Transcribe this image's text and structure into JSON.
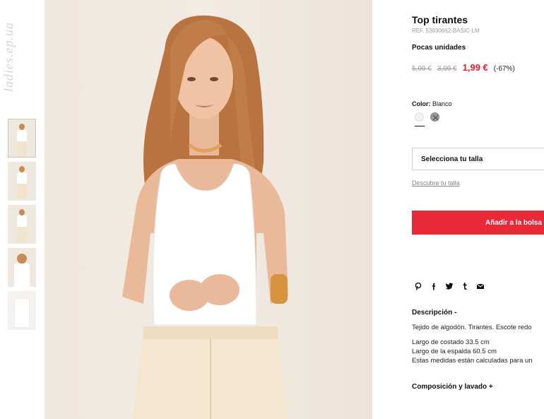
{
  "watermark": "ladies.ep.ua",
  "thumbnails": [
    "thumb-1",
    "thumb-2",
    "thumb-3",
    "thumb-4",
    "thumb-5"
  ],
  "product": {
    "title": "Top tirantes",
    "ref": "REF. 53030662-BASIC-LM",
    "stock": "Pocas unidades",
    "prices": {
      "old1": "5,99 €",
      "old2": "3,99 €",
      "sale": "1,99 €",
      "discount": "(-67%)"
    },
    "color_label": "Color:",
    "color_value": "Blanco",
    "swatches": [
      {
        "name": "Blanco",
        "hex": "#f2f2f2"
      },
      {
        "name": "Gris",
        "hex": "#9a9a9a"
      }
    ],
    "size_select": "Selecciona tu talla",
    "size_link": "Descubre tu talla",
    "add_button": "Añadir a la bolsa",
    "share_icons": [
      "pinterest-icon",
      "facebook-icon",
      "twitter-icon",
      "tumblr-icon",
      "mail-icon"
    ],
    "description_header": "Descripción -",
    "description_lines": [
      "Tejido de algodón. Tirantes. Escote redo",
      "Largo de costado 33.5 cm",
      "Largo de la espalda 60.5 cm",
      "Estas medidas están calculadas para un"
    ],
    "composition_header": "Composición y lavado +"
  },
  "colors": {
    "accent": "#e8293a",
    "sale_price": "#e21b2e"
  }
}
